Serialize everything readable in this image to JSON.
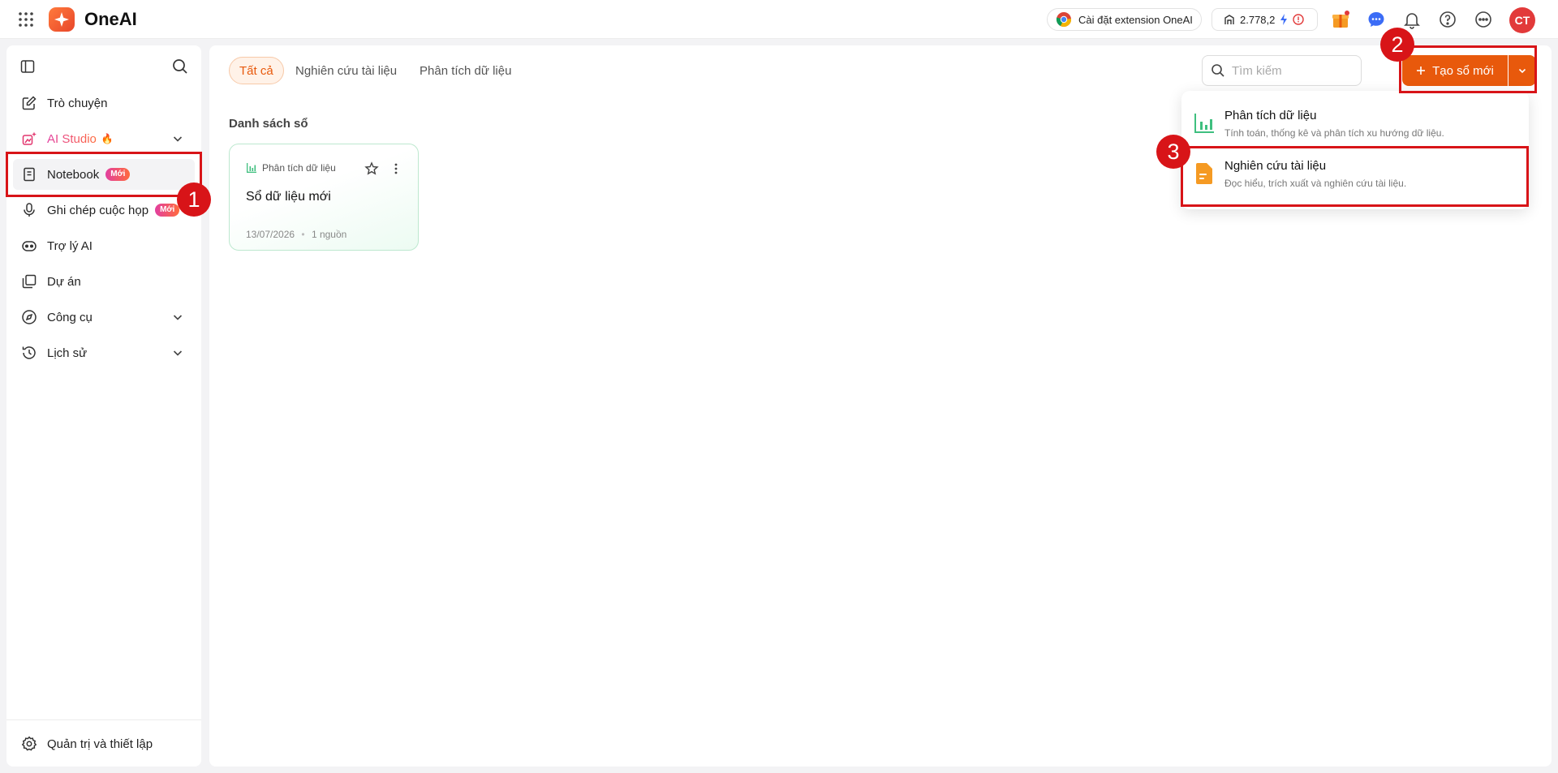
{
  "topbar": {
    "app_name": "OneAI",
    "extension_label": "Cài đặt extension OneAI",
    "credits": "2.778,2",
    "avatar_initials": "CT",
    "icons": [
      "apps-grid-icon",
      "chrome-icon",
      "credit-icon",
      "bolt-icon",
      "alert-icon",
      "gift-icon",
      "chat-icon",
      "bell-icon",
      "help-icon",
      "more-icon"
    ]
  },
  "sidebar": {
    "items": [
      {
        "label": "Trò chuyện",
        "icon": "edit-icon"
      },
      {
        "label": "AI Studio",
        "icon": "ai-studio-icon",
        "emoji": "🔥"
      },
      {
        "label": "Notebook",
        "icon": "notebook-icon",
        "badge": "Mới"
      },
      {
        "label": "Ghi chép cuộc họp",
        "icon": "mic-icon",
        "badge": "Mới"
      },
      {
        "label": "Trợ lý AI",
        "icon": "robot-icon"
      },
      {
        "label": "Dự án",
        "icon": "folder-icon"
      },
      {
        "label": "Công cụ",
        "icon": "compass-icon"
      },
      {
        "label": "Lịch sử",
        "icon": "history-icon"
      }
    ],
    "footer": {
      "label": "Quản trị và thiết lập",
      "icon": "gear-icon"
    }
  },
  "main": {
    "tabs": [
      {
        "label": "Tất cả",
        "active": true
      },
      {
        "label": "Nghiên cứu tài liệu"
      },
      {
        "label": "Phân tích dữ liệu"
      }
    ],
    "search": {
      "placeholder": "Tìm kiếm",
      "value": ""
    },
    "create_label": "Tạo sổ mới",
    "section_title": "Danh sách sổ",
    "notebooks": [
      {
        "type": "Phân tích dữ liệu",
        "title": "Sổ dữ liệu mới",
        "date": "13/07/2026",
        "sources": "1 nguồn"
      }
    ]
  },
  "create_menu": {
    "items": [
      {
        "title": "Phân tích dữ liệu",
        "desc": "Tính toán, thống kê và phân tích xu hướng dữ liệu."
      },
      {
        "title": "Nghiên cứu tài liệu",
        "desc": "Đọc hiểu, trích xuất và nghiên cứu tài liệu."
      }
    ]
  },
  "annotations": [
    "1",
    "2",
    "3"
  ],
  "colors": {
    "accent": "#e8590c",
    "annotation": "#d81418",
    "data_green": "#3fbf7f",
    "doc_orange": "#f59a23"
  }
}
